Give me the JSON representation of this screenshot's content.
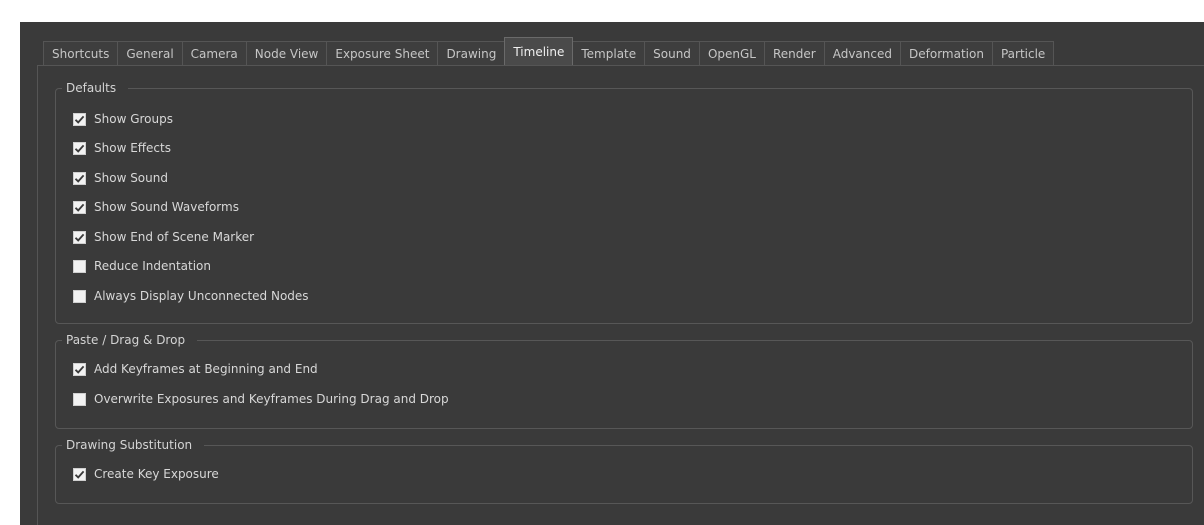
{
  "tabs": [
    {
      "label": "Shortcuts",
      "active": false
    },
    {
      "label": "General",
      "active": false
    },
    {
      "label": "Camera",
      "active": false
    },
    {
      "label": "Node View",
      "active": false
    },
    {
      "label": "Exposure Sheet",
      "active": false
    },
    {
      "label": "Drawing",
      "active": false
    },
    {
      "label": "Timeline",
      "active": true
    },
    {
      "label": "Template",
      "active": false
    },
    {
      "label": "Sound",
      "active": false
    },
    {
      "label": "OpenGL",
      "active": false
    },
    {
      "label": "Render",
      "active": false
    },
    {
      "label": "Advanced",
      "active": false
    },
    {
      "label": "Deformation",
      "active": false
    },
    {
      "label": "Particle",
      "active": false
    }
  ],
  "groups": {
    "defaults": {
      "title": "Defaults",
      "options": [
        {
          "label": "Show Groups",
          "checked": true
        },
        {
          "label": "Show Effects",
          "checked": true
        },
        {
          "label": "Show Sound",
          "checked": true
        },
        {
          "label": "Show Sound Waveforms",
          "checked": true
        },
        {
          "label": "Show End of Scene Marker",
          "checked": true
        },
        {
          "label": "Reduce Indentation",
          "checked": false
        },
        {
          "label": "Always Display Unconnected Nodes",
          "checked": false
        }
      ]
    },
    "paste_drag_drop": {
      "title": "Paste / Drag  & Drop",
      "options": [
        {
          "label": "Add Keyframes at Beginning and End",
          "checked": true
        },
        {
          "label": "Overwrite Exposures and Keyframes During Drag and Drop",
          "checked": false
        }
      ]
    },
    "drawing_substitution": {
      "title": "Drawing Substitution",
      "options": [
        {
          "label": "Create Key Exposure",
          "checked": true
        }
      ]
    }
  },
  "colors": {
    "background": "#3a3a3a",
    "checkbox_fill": "#f2f2f2",
    "checkmark": "#3a3a3a"
  }
}
